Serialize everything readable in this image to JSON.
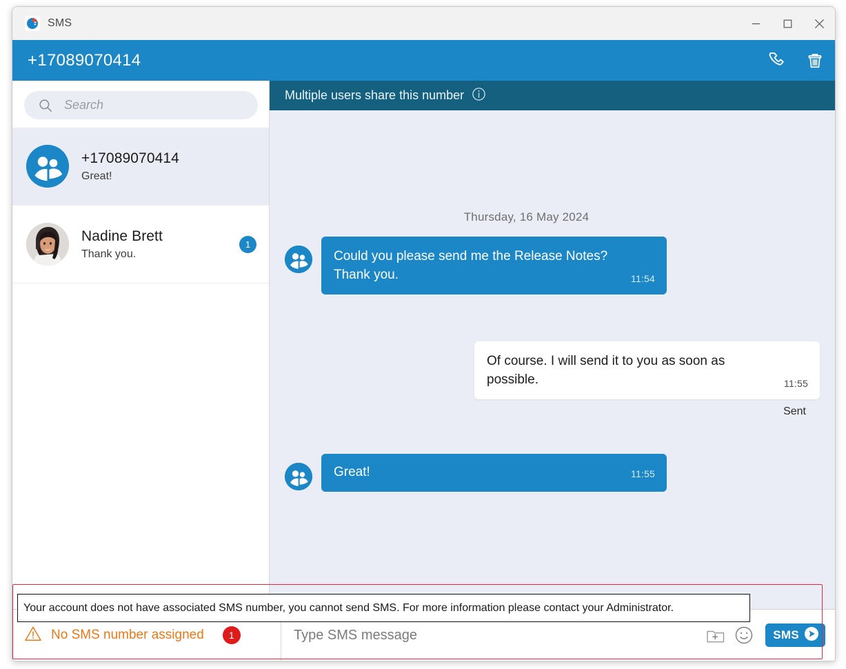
{
  "window": {
    "app_title": "SMS",
    "logo_icon": "sms-app-logo-icon",
    "minimize_label": "—",
    "maximize_label": "□",
    "close_label": "✕"
  },
  "header": {
    "number": "+17089070414",
    "call_icon": "phone-icon",
    "delete_icon": "trash-icon"
  },
  "sidebar": {
    "search": {
      "placeholder": "Search",
      "value": "",
      "icon": "search-icon"
    },
    "conversations": [
      {
        "name": "+17089070414",
        "preview": "Great!",
        "avatar_type": "group",
        "avatar_icon": "group-avatar-icon",
        "unread": "",
        "selected": true
      },
      {
        "name": "Nadine Brett",
        "preview": "Thank you.",
        "avatar_type": "photo",
        "avatar_icon": "person-photo-avatar",
        "unread": "1",
        "selected": false
      }
    ]
  },
  "chat": {
    "banner": {
      "text": "Multiple users share this number",
      "icon": "info-icon"
    },
    "date_separator": "Thursday, 16 May 2024",
    "messages": [
      {
        "direction": "in",
        "text": "Could you please send me the Release Notes? Thank you.",
        "time": "11:54",
        "avatar_icon": "group-avatar-icon",
        "status": ""
      },
      {
        "direction": "out",
        "text": "Of course. I will send it to you as soon as possible.",
        "time": "11:55",
        "avatar_icon": "",
        "status": "Sent"
      },
      {
        "direction": "in",
        "text": "Great!",
        "time": "11:55",
        "avatar_icon": "group-avatar-icon",
        "status": ""
      }
    ]
  },
  "bottom": {
    "warning_text": "No SMS number assigned",
    "warning_icon": "warning-triangle-icon",
    "warning_badge": "1",
    "composer_placeholder": "Type SMS message",
    "composer_value": "",
    "attach_icon": "add-attachment-icon",
    "emoji_icon": "emoji-smiley-icon",
    "send_label": "SMS",
    "send_icon": "send-arrow-icon"
  },
  "tooltip": {
    "text": "Your account does not have associated SMS number, you cannot send SMS. For more information please contact your Administrator."
  },
  "colors": {
    "accent_blue": "#1b87c6",
    "banner_blue": "#15607f",
    "chat_bg": "#eaedf5",
    "warning_orange": "#f07814",
    "badge_red": "#e01b1b",
    "highlight_red": "#e0293f"
  }
}
